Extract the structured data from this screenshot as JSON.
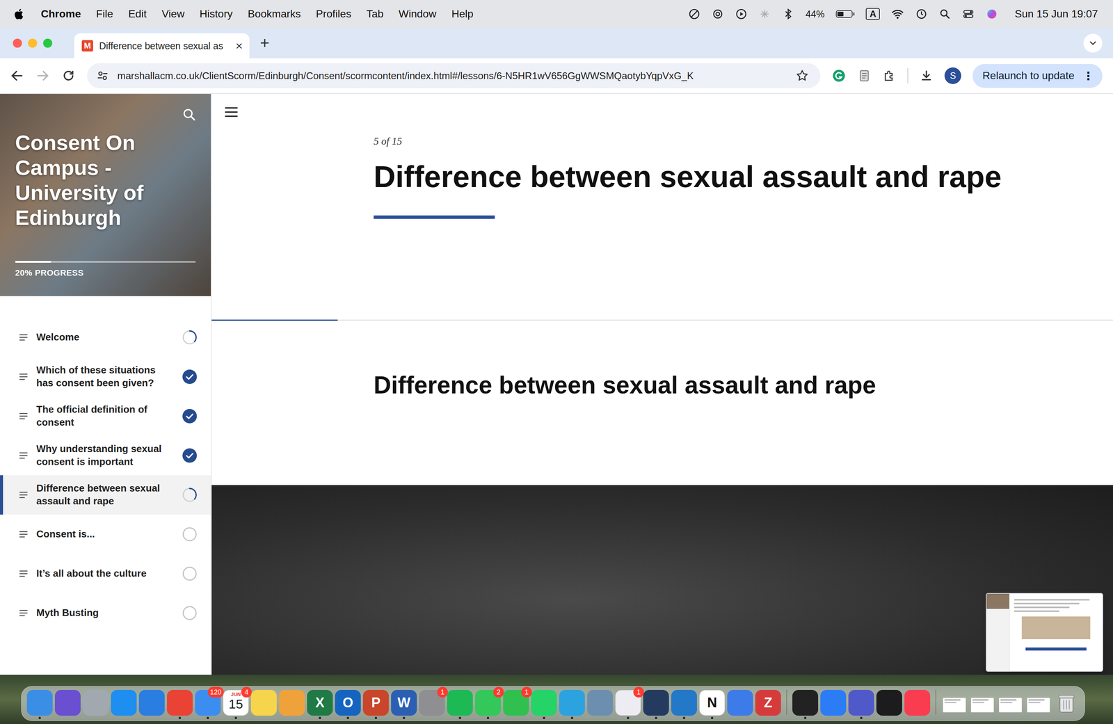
{
  "menubar": {
    "app": "Chrome",
    "items": [
      "File",
      "Edit",
      "View",
      "History",
      "Bookmarks",
      "Profiles",
      "Tab",
      "Window",
      "Help"
    ],
    "battery": {
      "reading": "44%",
      "level": 0.44
    },
    "input_source": "A",
    "clock": "Sun 15 Jun 19:07"
  },
  "browser": {
    "tab": {
      "favicon": "M",
      "title": "Difference between sexual as",
      "close": "×",
      "selected": true
    },
    "new_tab": "+",
    "forward_enabled": false,
    "url": "marshallacm.co.uk/ClientScorm/Edinburgh/Consent/scormcontent/index.html#/lessons/6-N5HR1wV656GgWWSMQaotybYqpVxG_K",
    "profile": "S",
    "relaunch": "Relaunch to update",
    "menu": "⋮"
  },
  "sidebar": {
    "title": "Consent On Campus - University of Edinburgh",
    "progress": {
      "label": "20% PROGRESS",
      "level": 0.2
    },
    "lessons": [
      {
        "title": "Welcome",
        "completed": false,
        "started": true,
        "selected": false
      },
      {
        "title": "Which of these situations has consent been given?",
        "completed": true,
        "started": true,
        "selected": false
      },
      {
        "title": "The official definition of consent",
        "completed": true,
        "started": true,
        "selected": false
      },
      {
        "title": "Why understanding sexual consent is important",
        "completed": true,
        "started": true,
        "selected": false
      },
      {
        "title": "Difference between sexual assault and rape",
        "completed": false,
        "started": true,
        "selected": true
      },
      {
        "title": "Consent is...",
        "completed": false,
        "started": false,
        "selected": false
      },
      {
        "title": "It’s all about the culture",
        "completed": false,
        "started": false,
        "selected": false
      },
      {
        "title": "Myth Busting",
        "completed": false,
        "started": false,
        "selected": false
      }
    ]
  },
  "lesson": {
    "counter": "5 of 15",
    "title": "Difference between sexual assault and rape",
    "progress_level": 0.14,
    "heading": "Difference between sexual assault and rape"
  },
  "dock": {
    "items": [
      {
        "kind": "app",
        "color": "#3a8ee6",
        "running": true
      },
      {
        "kind": "app",
        "color": "#6a4fd0",
        "running": false
      },
      {
        "kind": "app",
        "color": "#a2a8b0",
        "running": false
      },
      {
        "kind": "app",
        "color": "#1e8ef0",
        "running": false
      },
      {
        "kind": "app",
        "color": "#2a7de1",
        "running": false
      },
      {
        "kind": "app",
        "color": "#e94335",
        "running": true
      },
      {
        "kind": "app",
        "color": "#3c8df0",
        "running": true,
        "badge": "120"
      },
      {
        "kind": "calendar",
        "month": "JUN",
        "day": "15",
        "badge": "4",
        "running": true
      },
      {
        "kind": "app",
        "color": "#f6d44c",
        "running": false
      },
      {
        "kind": "app",
        "color": "#f0a23a",
        "running": false
      },
      {
        "kind": "app",
        "color": "#1f7a45",
        "glyph": "X",
        "running": true
      },
      {
        "kind": "app",
        "color": "#1565c0",
        "glyph": "O",
        "running": true
      },
      {
        "kind": "app",
        "color": "#c9452b",
        "glyph": "P",
        "running": true
      },
      {
        "kind": "app",
        "color": "#2b5fb4",
        "glyph": "W",
        "running": true
      },
      {
        "kind": "app",
        "color": "#8e8e93",
        "badge": "1",
        "running": false
      },
      {
        "kind": "app",
        "color": "#1db954",
        "running": true
      },
      {
        "kind": "app",
        "color": "#34c759",
        "badge": "2",
        "running": true
      },
      {
        "kind": "app",
        "color": "#30c04f",
        "badge": "1",
        "running": false
      },
      {
        "kind": "app",
        "color": "#25d366",
        "running": true
      },
      {
        "kind": "app",
        "color": "#2aa3e0",
        "running": true
      },
      {
        "kind": "app",
        "color": "#6c8fb0",
        "running": false
      },
      {
        "kind": "app",
        "color": "#ececf2",
        "badge": "1",
        "running": true
      },
      {
        "kind": "app",
        "color": "#243a5e",
        "running": true
      },
      {
        "kind": "app",
        "color": "#2378c8",
        "running": true
      },
      {
        "kind": "app",
        "color": "#ffffff",
        "glyph": "N",
        "running": true
      },
      {
        "kind": "app",
        "color": "#3d7be8",
        "running": false
      },
      {
        "kind": "app",
        "color": "#d63b3b",
        "glyph": "Z",
        "running": false
      },
      {
        "kind": "divider"
      },
      {
        "kind": "app",
        "color": "#222222",
        "running": true
      },
      {
        "kind": "app",
        "color": "#2c7cf6",
        "running": false
      },
      {
        "kind": "app",
        "color": "#5059c9",
        "running": true
      },
      {
        "kind": "app",
        "color": "#1c1c1e",
        "running": false
      },
      {
        "kind": "app",
        "color": "#fa3c50",
        "running": false
      },
      {
        "kind": "divider"
      },
      {
        "kind": "window"
      },
      {
        "kind": "window"
      },
      {
        "kind": "window"
      },
      {
        "kind": "window"
      },
      {
        "kind": "trash"
      }
    ]
  }
}
